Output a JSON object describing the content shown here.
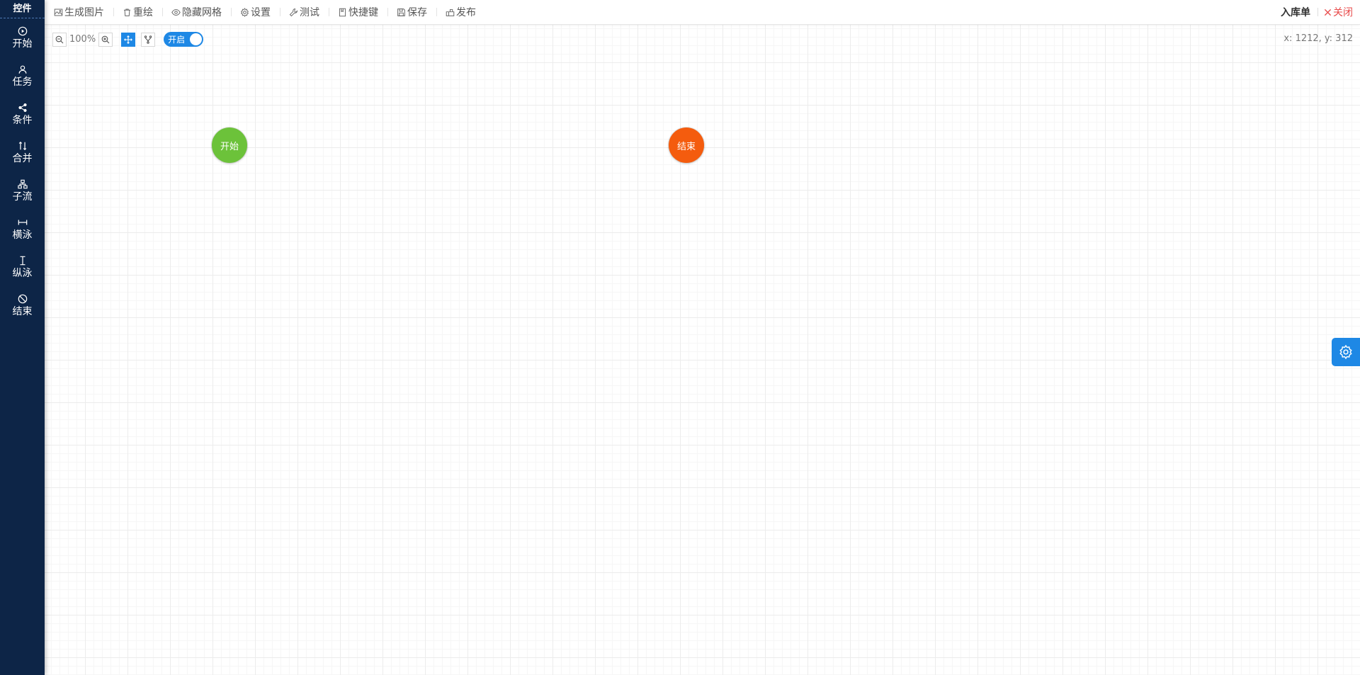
{
  "sidebar": {
    "title": "控件",
    "items": [
      {
        "label": "开始",
        "icon": "play-circle-icon"
      },
      {
        "label": "任务",
        "icon": "user-icon"
      },
      {
        "label": "条件",
        "icon": "share-icon"
      },
      {
        "label": "合并",
        "icon": "merge-icon"
      },
      {
        "label": "子流",
        "icon": "hierarchy-icon"
      },
      {
        "label": "横泳",
        "icon": "horizontal-lane-icon"
      },
      {
        "label": "纵泳",
        "icon": "vertical-lane-icon"
      },
      {
        "label": "结束",
        "icon": "stop-icon"
      }
    ]
  },
  "toolbar": {
    "items": [
      {
        "label": "生成图片",
        "icon": "image-icon"
      },
      {
        "label": "重绘",
        "icon": "trash-icon"
      },
      {
        "label": "隐藏网格",
        "icon": "eye-icon"
      },
      {
        "label": "设置",
        "icon": "gear-icon"
      },
      {
        "label": "测试",
        "icon": "wrench-icon"
      },
      {
        "label": "快捷键",
        "icon": "bookmark-icon"
      },
      {
        "label": "保存",
        "icon": "save-icon"
      },
      {
        "label": "发布",
        "icon": "publish-icon"
      }
    ],
    "right_title": "入库单",
    "close_label": "关闭"
  },
  "canvas": {
    "zoom": "100%",
    "toggle_label": "开启",
    "coords": "x: 1212, y: 312"
  },
  "nodes": {
    "start": {
      "label": "开始",
      "color": "#6cc23a"
    },
    "end": {
      "label": "结束",
      "color": "#f45c0e"
    }
  },
  "colors": {
    "sidebar_bg": "#0d2547",
    "accent": "#1e88e5",
    "close": "#e84a4a"
  }
}
